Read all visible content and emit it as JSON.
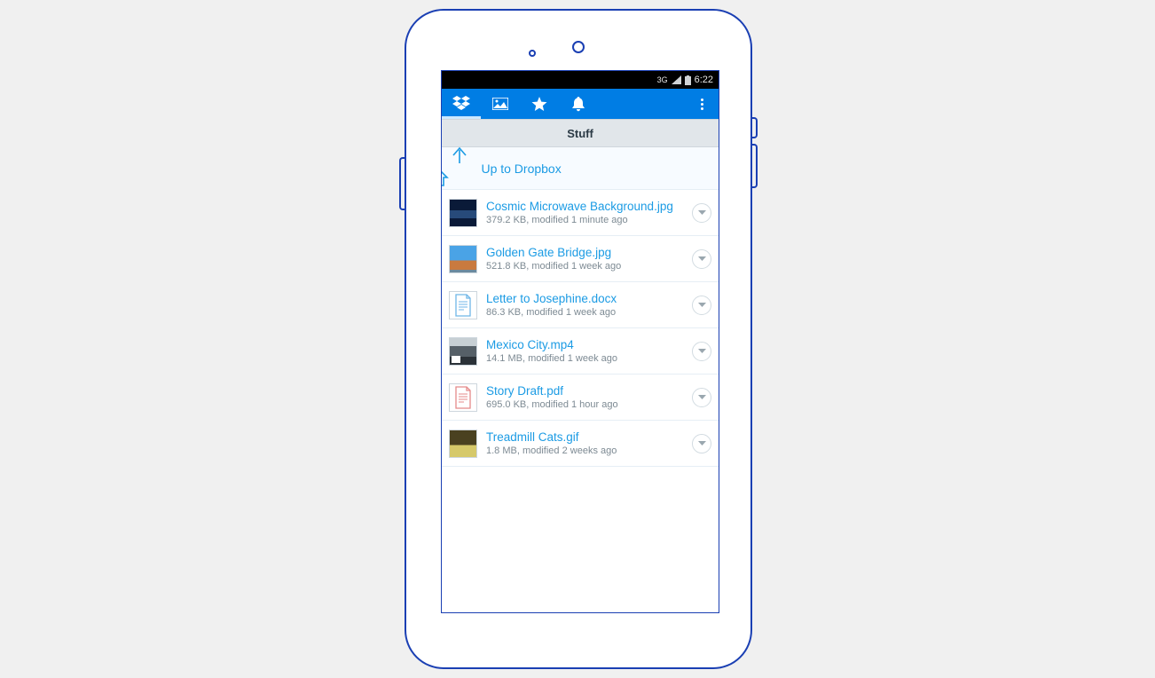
{
  "statusbar": {
    "network_label": "3G",
    "clock": "6:22"
  },
  "actionbar": {
    "tabs": [
      {
        "name": "dropbox-tab",
        "icon": "dropbox-icon",
        "active": true
      },
      {
        "name": "photos-tab",
        "icon": "photo-icon",
        "active": false
      },
      {
        "name": "favorites-tab",
        "icon": "star-icon",
        "active": false
      },
      {
        "name": "notifications-tab",
        "icon": "bell-icon",
        "active": false
      }
    ]
  },
  "folder": {
    "title": "Stuff",
    "up_label": "Up to Dropbox"
  },
  "files": [
    {
      "name": "Cosmic Microwave Background.jpg",
      "meta": "379.2 KB, modified 1 minute ago",
      "thumb": "img-cosmic"
    },
    {
      "name": "Golden Gate Bridge.jpg",
      "meta": "521.8 KB, modified 1 week ago",
      "thumb": "img-ggb"
    },
    {
      "name": "Letter to Josephine.docx",
      "meta": "86.3 KB, modified 1 week ago",
      "thumb": "doc"
    },
    {
      "name": "Mexico City.mp4",
      "meta": "14.1 MB, modified 1 week ago",
      "thumb": "img-mexico"
    },
    {
      "name": "Story Draft.pdf",
      "meta": "695.0 KB, modified 1 hour ago",
      "thumb": "pdf"
    },
    {
      "name": "Treadmill Cats.gif",
      "meta": "1.8 MB, modified 2 weeks ago",
      "thumb": "img-cats"
    }
  ]
}
